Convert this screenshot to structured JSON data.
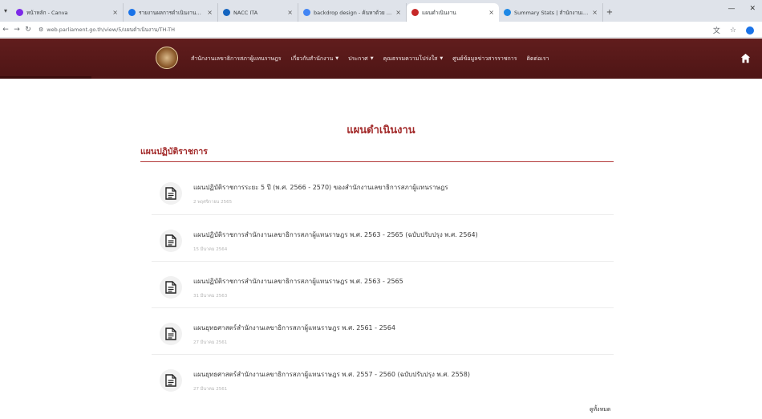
{
  "browser": {
    "tabs": [
      {
        "title": "หน้าหลัก - Canva",
        "color": "#7d2ae8",
        "width": 140,
        "active": false
      },
      {
        "title": "รายงานผลการดำเนินงานตามแผน",
        "color": "#1a73e8",
        "width": 118,
        "active": false
      },
      {
        "title": "NACC ITA",
        "color": "#1565c0",
        "width": 100,
        "active": false
      },
      {
        "title": "backdrop design - ค้นหาด้วย Google",
        "color": "#4285f4",
        "width": 135,
        "active": false
      },
      {
        "title": "แผนดำเนินงาน",
        "color": "#c62828",
        "width": 115,
        "active": true
      },
      {
        "title": "Summary Stats | สำนักงานเลขาธิการ",
        "color": "#1e88e5",
        "width": 130,
        "active": false
      }
    ],
    "url": "web.parliament.go.th/view/5/แผนดำเนินงาน/TH-TH"
  },
  "site": {
    "menu": [
      {
        "label": "สำนักงานเลขาธิการสภาผู้แทนราษฎร",
        "caret": false
      },
      {
        "label": "เกี่ยวกับสำนักงาน",
        "caret": true
      },
      {
        "label": "ประกาศ",
        "caret": true
      },
      {
        "label": "คุณธรรมความโปร่งใส",
        "caret": true
      },
      {
        "label": "ศูนย์ข้อมูลข่าวสารราชการ",
        "caret": false
      },
      {
        "label": "ติดต่อเรา",
        "caret": false
      }
    ]
  },
  "page": {
    "title": "แผนดำเนินงาน",
    "section_title": "แผนปฏิบัติราชการ",
    "more_label": "ดูทั้งหมด"
  },
  "items": [
    {
      "title": "แผนปฏิบัติราชการระยะ 5 ปี (พ.ศ. 2566 - 2570) ของสำนักงานเลขาธิการสภาผู้แทนราษฎร",
      "date": "2 พฤศจิกายน 2565"
    },
    {
      "title": "แผนปฏิบัติราชการสำนักงานเลขาธิการสภาผู้แทนราษฎร พ.ศ. 2563 - 2565 (ฉบับปรับปรุง พ.ศ. 2564)",
      "date": "15 มีนาคม 2564"
    },
    {
      "title": "แผนปฏิบัติราชการสำนักงานเลขาธิการสภาผู้แทนราษฎร พ.ศ. 2563 - 2565",
      "date": "31 มีนาคม 2563"
    },
    {
      "title": "แผนยุทธศาสตร์สำนักงานเลขาธิการสภาผู้แทนราษฎร พ.ศ. 2561 - 2564",
      "date": "27 มีนาคม 2561"
    },
    {
      "title": "แผนยุทธศาสตร์สำนักงานเลขาธิการสภาผู้แทนราษฎร พ.ศ. 2557 - 2560 (ฉบับปรับปรุง พ.ศ. 2558)",
      "date": "27 มีนาคม 2561"
    }
  ]
}
